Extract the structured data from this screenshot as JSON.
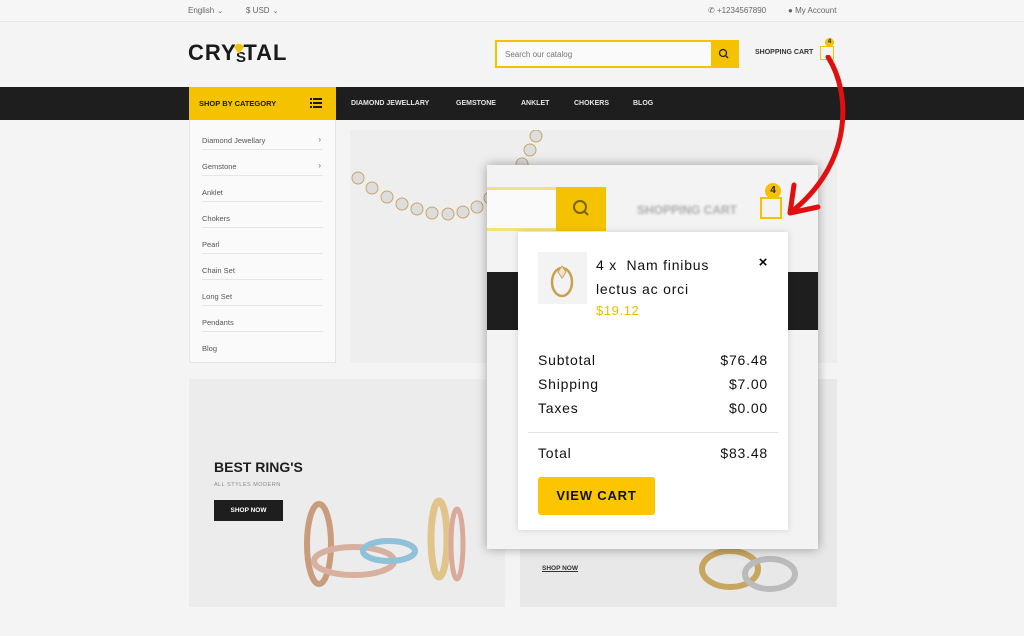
{
  "topbar": {
    "language": "English",
    "currency": "$ USD",
    "phone": "+1234567890",
    "account": "My Account"
  },
  "header": {
    "logo_text": "CRY TAL",
    "logo_s": "S",
    "search_placeholder": "Search our catalog",
    "cart_label": "SHOPPING CART",
    "cart_count": "4"
  },
  "nav": {
    "category_button": "SHOP BY CATEGORY",
    "links": [
      "DIAMOND JEWELLARY",
      "GEMSTONE",
      "ANKLET",
      "CHOKERS",
      "BLOG"
    ]
  },
  "sidebar": {
    "items": [
      {
        "label": "Diamond Jewellary",
        "arrow": "›"
      },
      {
        "label": "Gemstone",
        "arrow": "›"
      },
      {
        "label": "Anklet",
        "arrow": ""
      },
      {
        "label": "Chokers",
        "arrow": ""
      },
      {
        "label": "Pearl",
        "arrow": ""
      },
      {
        "label": "Chain Set",
        "arrow": ""
      },
      {
        "label": "Long Set",
        "arrow": ""
      },
      {
        "label": "Pendants",
        "arrow": ""
      },
      {
        "label": "Blog",
        "arrow": ""
      }
    ]
  },
  "banners": {
    "left_title": "BEST RING'S",
    "left_sub": "ALL STYLES MODERN",
    "left_button": "SHOP NOW",
    "right_link": "SHOP NOW"
  },
  "popup": {
    "blurred_cart_label": "SHOPPING CART",
    "badge": "4",
    "item_line1": "4 x  Nam finibus",
    "item_line2": "lectus ac orci",
    "item_price": "$19.12",
    "close": "×",
    "subtotal_label": "Subtotal",
    "subtotal_value": "$76.48",
    "shipping_label": "Shipping",
    "shipping_value": "$7.00",
    "taxes_label": "Taxes",
    "taxes_value": "$0.00",
    "total_label": "Total",
    "total_value": "$83.48",
    "view_cart": "VIEW CART"
  },
  "colors": {
    "accent": "#F5C200",
    "dark": "#1E1E1E",
    "price": "#F5B800",
    "annotation_arrow": "#E01010"
  }
}
